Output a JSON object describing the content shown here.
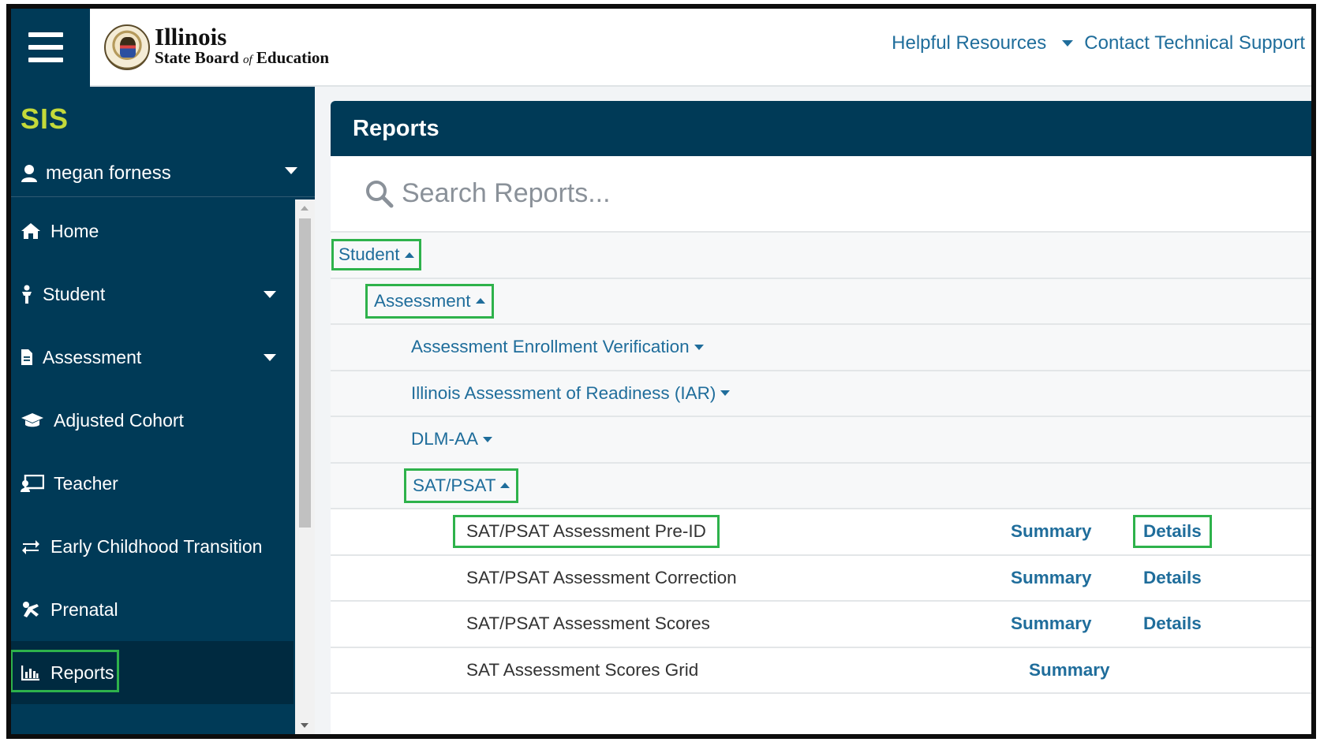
{
  "header": {
    "logo_line1": "Illinois",
    "logo_line2_a": "State Board",
    "logo_line2_of": "of",
    "logo_line2_b": "Education",
    "helpful_resources": "Helpful Resources",
    "contact_support": "Contact Technical Support"
  },
  "sidebar": {
    "app_name": "SIS",
    "user_name": "megan forness",
    "items": [
      {
        "label": "Home",
        "icon": "home-icon"
      },
      {
        "label": "Student",
        "icon": "student-icon"
      },
      {
        "label": "Assessment",
        "icon": "document-icon"
      },
      {
        "label": "Adjusted Cohort",
        "icon": "graduation-cap-icon"
      },
      {
        "label": "Teacher",
        "icon": "teacher-icon"
      },
      {
        "label": "Early Childhood Transition",
        "icon": "exchange-icon"
      },
      {
        "label": "Prenatal",
        "icon": "baby-icon"
      },
      {
        "label": "Reports",
        "icon": "bar-chart-icon"
      }
    ]
  },
  "panel": {
    "title": "Reports",
    "search_placeholder": "Search Reports...",
    "tree": {
      "student": "Student",
      "assessment": "Assessment",
      "aev": "Assessment Enrollment Verification",
      "iar": "Illinois Assessment of Readiness (IAR)",
      "dlm": "DLM-AA",
      "sat_psat": "SAT/PSAT"
    },
    "reports": [
      {
        "name": "SAT/PSAT Assessment Pre-ID",
        "summary": "Summary",
        "details": "Details"
      },
      {
        "name": "SAT/PSAT Assessment Correction",
        "summary": "Summary",
        "details": "Details"
      },
      {
        "name": "SAT/PSAT Assessment Scores",
        "summary": "Summary",
        "details": "Details"
      },
      {
        "name": "SAT Assessment Scores Grid",
        "summary": "Summary"
      }
    ]
  },
  "colors": {
    "navy": "#003a57",
    "link_blue": "#1f6d9b",
    "highlight_green": "#2eb24b",
    "sis_green": "#c4d93a"
  }
}
